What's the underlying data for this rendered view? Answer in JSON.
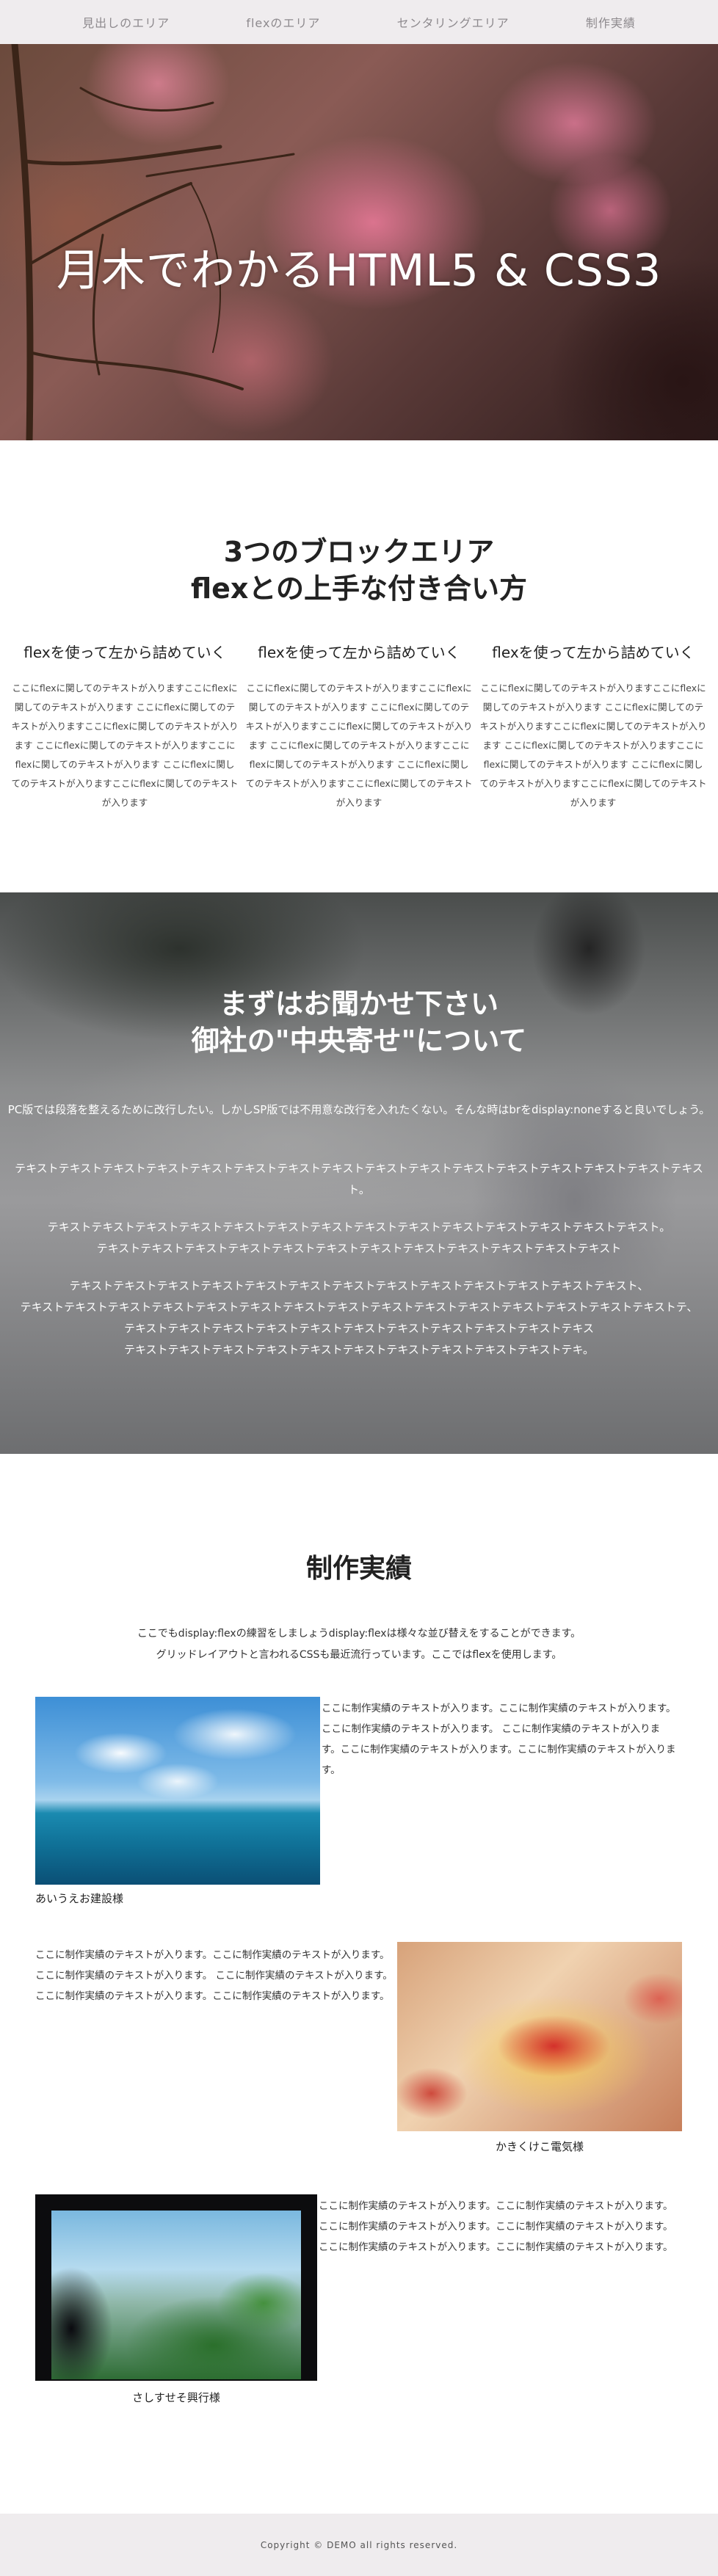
{
  "nav": {
    "items": [
      {
        "label": "見出しのエリア"
      },
      {
        "label": "flexのエリア"
      },
      {
        "label": "センタリングエリア"
      },
      {
        "label": "制作実績"
      }
    ]
  },
  "hero": {
    "title": "月木でわかるHTML5 & CSS3"
  },
  "blocks": {
    "title_line1": "3つのブロックエリア",
    "title_line2": "flexとの上手な付き合い方",
    "columns": [
      {
        "heading": "flexを使って左から詰めていく",
        "text": "ここにflexに関してのテキストが入りますここにflexに関してのテキストが入ります ここにflexに関してのテキストが入りますここにflexに関してのテキストが入ります ここにflexに関してのテキストが入りますここにflexに関してのテキストが入ります ここにflexに関してのテキストが入りますここにflexに関してのテキストが入ります"
      },
      {
        "heading": "flexを使って左から詰めていく",
        "text": "ここにflexに関してのテキストが入りますここにflexに関してのテキストが入ります ここにflexに関してのテキストが入りますここにflexに関してのテキストが入ります ここにflexに関してのテキストが入りますここにflexに関してのテキストが入ります ここにflexに関してのテキストが入りますここにflexに関してのテキストが入ります"
      },
      {
        "heading": "flexを使って左から詰めていく",
        "text": "ここにflexに関してのテキストが入りますここにflexに関してのテキストが入ります ここにflexに関してのテキストが入りますここにflexに関してのテキストが入ります ここにflexに関してのテキストが入りますここにflexに関してのテキストが入ります ここにflexに関してのテキストが入りますここにflexに関してのテキストが入ります"
      }
    ]
  },
  "center": {
    "title_line1": "まずはお聞かせ下さい",
    "title_line2": "御社の\"中央寄せ\"について",
    "para1": "PC版では段落を整えるために改行したい。しかしSP版では不用意な改行を入れたくない。そんな時はbrをdisplay:noneすると良いでしょう。",
    "para2": "テキストテキストテキストテキストテキストテキストテキストテキストテキストテキストテキストテキストテキストテキストテキストテキスト。",
    "para3_line1": "テキストテキストテキストテキストテキストテキストテキストテキストテキストテキストテキストテキストテキストテキスト。",
    "para3_line2": "テキストテキストテキストテキストテキストテキストテキストテキストテキストテキストテキストテキスト",
    "para4_line1": "テキストテキストテキストテキストテキストテキストテキストテキストテキストテキストテキストテキストテキスト、",
    "para4_line2": "テキストテキストテキストテキストテキストテキストテキストテキストテキストテキストテキストテキストテキストテキストテキストテ、",
    "para4_line3": "テキストテキストテキストテキストテキストテキストテキストテキストテキストテキストテキス",
    "para4_line4": "テキストテキストテキストテキストテキストテキストテキストテキストテキストテキストテキ。"
  },
  "works": {
    "title": "制作実績",
    "intro_line1": "ここでもdisplay:flexの練習をしましょうdisplay:flexは様々な並び替えをすることができます。",
    "intro_line2": "グリッドレイアウトと言われるCSSも最近流行っています。ここではflexを使用します。",
    "items": [
      {
        "caption": "あいうえお建設様",
        "text": "ここに制作実績のテキストが入ります。ここに制作実績のテキストが入ります。ここに制作実績のテキストが入ります。 ここに制作実績のテキストが入ります。ここに制作実績のテキストが入ります。ここに制作実績のテキストが入ります。"
      },
      {
        "caption": "かきくけこ電気様",
        "text": "ここに制作実績のテキストが入ります。ここに制作実績のテキストが入ります。ここに制作実績のテキストが入ります。 ここに制作実績のテキストが入ります。ここに制作実績のテキストが入ります。ここに制作実績のテキストが入ります。"
      },
      {
        "caption": "さしすせそ興行様",
        "text": "ここに制作実績のテキストが入ります。ここに制作実績のテキストが入ります。ここに制作実績のテキストが入ります。ここに制作実績のテキストが入ります。ここに制作実績のテキストが入ります。ここに制作実績のテキストが入ります。"
      }
    ]
  },
  "footer": {
    "copyright": "Copyright © DEMO all rights reserved."
  }
}
